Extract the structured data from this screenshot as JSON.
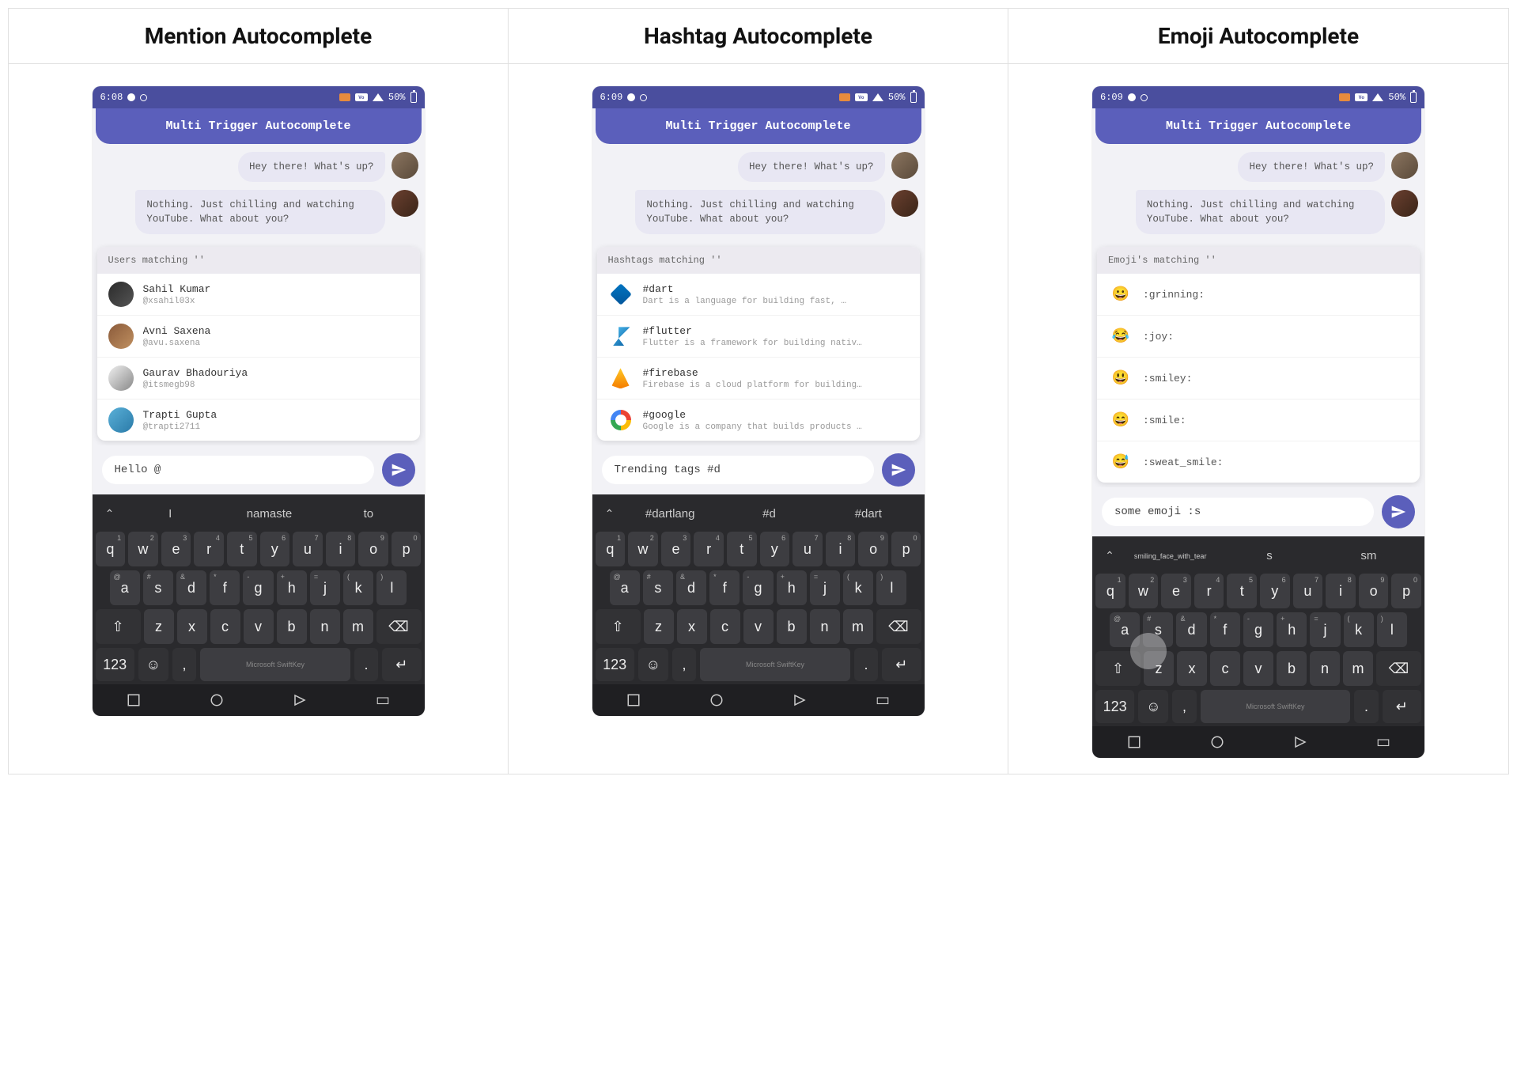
{
  "columns": [
    {
      "title": "Mention Autocomplete"
    },
    {
      "title": "Hashtag Autocomplete"
    },
    {
      "title": "Emoji Autocomplete"
    }
  ],
  "status": {
    "time_a": "6:08",
    "time_b": "6:09",
    "time_c": "6:09",
    "battery": "50%"
  },
  "appbar_title": "Multi Trigger Autocomplete",
  "chat": {
    "msg1": "Hey there! What's up?",
    "msg2": "Nothing. Just chilling and watching YouTube. What about you?"
  },
  "mention": {
    "header": "Users matching ''",
    "items": [
      {
        "name": "Sahil Kumar",
        "handle": "@xsahil03x"
      },
      {
        "name": "Avni Saxena",
        "handle": "@avu.saxena"
      },
      {
        "name": "Gaurav Bhadouriya",
        "handle": "@itsmegb98"
      },
      {
        "name": "Trapti Gupta",
        "handle": "@trapti2711"
      }
    ],
    "input": "Hello @",
    "suggestions": [
      "I",
      "namaste",
      "to"
    ]
  },
  "hashtag": {
    "header": "Hashtags matching ''",
    "items": [
      {
        "tag": "#dart",
        "desc": "Dart is a language for building fast, …"
      },
      {
        "tag": "#flutter",
        "desc": "Flutter is a framework for building nativ…"
      },
      {
        "tag": "#firebase",
        "desc": "Firebase is a cloud platform for building…"
      },
      {
        "tag": "#google",
        "desc": "Google is a company that builds products …"
      }
    ],
    "input": "Trending tags #d",
    "suggestions": [
      "#dartlang",
      "#d",
      "#dart"
    ]
  },
  "emoji": {
    "header": "Emoji's matching ''",
    "items": [
      {
        "glyph": "😀",
        "code": ":grinning:"
      },
      {
        "glyph": "😂",
        "code": ":joy:"
      },
      {
        "glyph": "😃",
        "code": ":smiley:"
      },
      {
        "glyph": "😄",
        "code": ":smile:"
      },
      {
        "glyph": "😅",
        "code": ":sweat_smile:"
      }
    ],
    "input": "some emoji :s",
    "suggestions": [
      "smiling_face_with_tear",
      "s",
      "sm"
    ]
  },
  "keyboard": {
    "row1": [
      "q",
      "w",
      "e",
      "r",
      "t",
      "y",
      "u",
      "i",
      "o",
      "p"
    ],
    "row1_nums": [
      "1",
      "2",
      "3",
      "4",
      "5",
      "6",
      "7",
      "8",
      "9",
      "0"
    ],
    "row2": [
      "a",
      "s",
      "d",
      "f",
      "g",
      "h",
      "j",
      "k",
      "l"
    ],
    "row2_syms": [
      "@",
      "#",
      "&",
      "*",
      "-",
      "+",
      "=",
      "(",
      ")"
    ],
    "row3": [
      "z",
      "x",
      "c",
      "v",
      "b",
      "n",
      "m"
    ],
    "numkey": "123",
    "brand": "Microsoft SwiftKey"
  }
}
